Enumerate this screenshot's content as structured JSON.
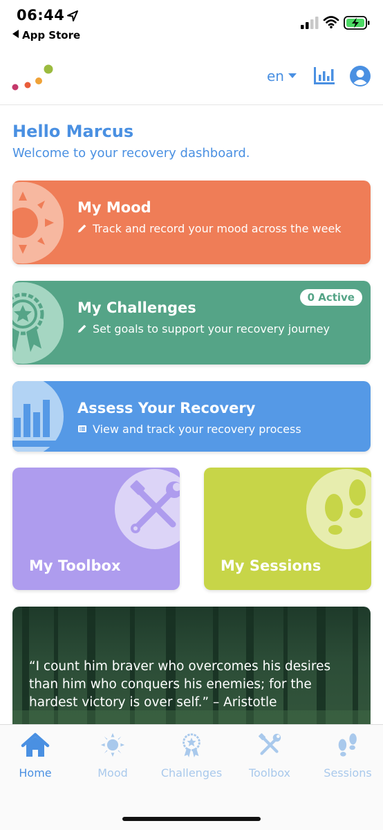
{
  "status_bar": {
    "time": "06:44",
    "back_app": "App Store"
  },
  "header": {
    "language": "en"
  },
  "greeting": {
    "title": "Hello Marcus",
    "subtitle": "Welcome to your recovery dashboard."
  },
  "cards": {
    "mood": {
      "title": "My Mood",
      "description": "Track and record your mood across the week",
      "color": "#ef7d57",
      "icon": "sun-icon"
    },
    "challenges": {
      "title": "My Challenges",
      "description": "Set goals to support your recovery journey",
      "badge": "0 Active",
      "color": "#55a487",
      "icon": "award-ribbon-icon"
    },
    "assess": {
      "title": "Assess Your Recovery",
      "description": "View and track your recovery process",
      "color": "#5599e6",
      "icon": "bar-chart-icon"
    },
    "toolbox": {
      "title": "My Toolbox",
      "color": "#ae9cee",
      "icon": "tools-icon"
    },
    "sessions": {
      "title": "My Sessions",
      "color": "#c7d548",
      "icon": "footprints-icon"
    }
  },
  "quote": {
    "text": "“I count him braver who overcomes his desires than him who conquers his enemies; for the hardest victory is over self.” – Aristotle"
  },
  "tabs": [
    {
      "label": "Home",
      "icon": "home-icon",
      "active": true
    },
    {
      "label": "Mood",
      "icon": "sun-icon",
      "active": false
    },
    {
      "label": "Challenges",
      "icon": "award-ribbon-icon",
      "active": false
    },
    {
      "label": "Toolbox",
      "icon": "tools-icon",
      "active": false
    },
    {
      "label": "Sessions",
      "icon": "footprints-icon",
      "active": false
    }
  ],
  "colors": {
    "accent": "#4a90e2",
    "tab_inactive": "#a9c9ec"
  }
}
